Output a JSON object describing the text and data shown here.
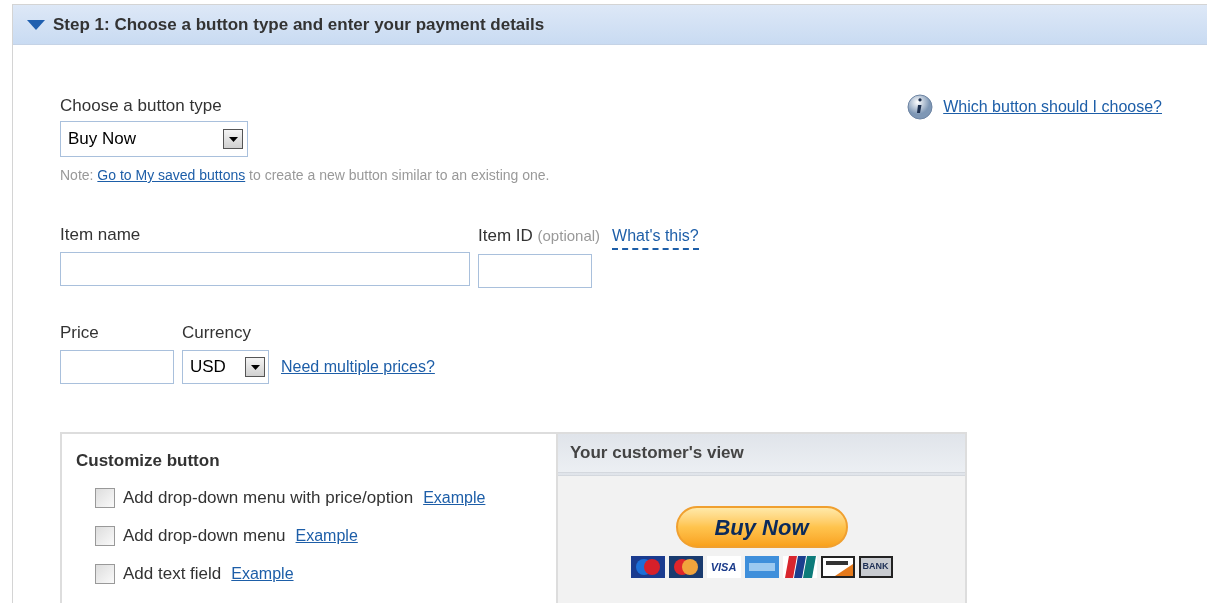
{
  "section": {
    "title": "Step 1: Choose a button type and enter your payment details",
    "expanded": true
  },
  "button_type": {
    "label": "Choose a button type",
    "value": "Buy Now"
  },
  "help_link": "Which button should I choose?",
  "note": {
    "prefix": "Note:",
    "link": "Go to My saved buttons",
    "suffix": "to create a new button similar to an existing one."
  },
  "item_name": {
    "label": "Item name"
  },
  "item_id": {
    "label": "Item ID",
    "hint": "(optional)",
    "link": "What's this?"
  },
  "price": {
    "label": "Price"
  },
  "currency": {
    "label": "Currency",
    "value": "USD",
    "link": "Need multiple prices?"
  },
  "customize": {
    "title": "Customize button",
    "options": [
      {
        "label": "Add drop-down menu with price/option",
        "link": "Example",
        "checked": false
      },
      {
        "label": "Add drop-down menu",
        "link": "Example",
        "checked": false
      },
      {
        "label": "Add text field",
        "link": "Example",
        "checked": false
      }
    ]
  },
  "preview": {
    "title": "Your customer's view",
    "button": "Buy Now",
    "cards": [
      {
        "kind": "maestro"
      },
      {
        "kind": "mastercard"
      },
      {
        "kind": "visa",
        "label": "VISA"
      },
      {
        "kind": "amex"
      },
      {
        "kind": "unionpay"
      },
      {
        "kind": "discover"
      },
      {
        "kind": "bank",
        "label": "BANK"
      }
    ]
  }
}
